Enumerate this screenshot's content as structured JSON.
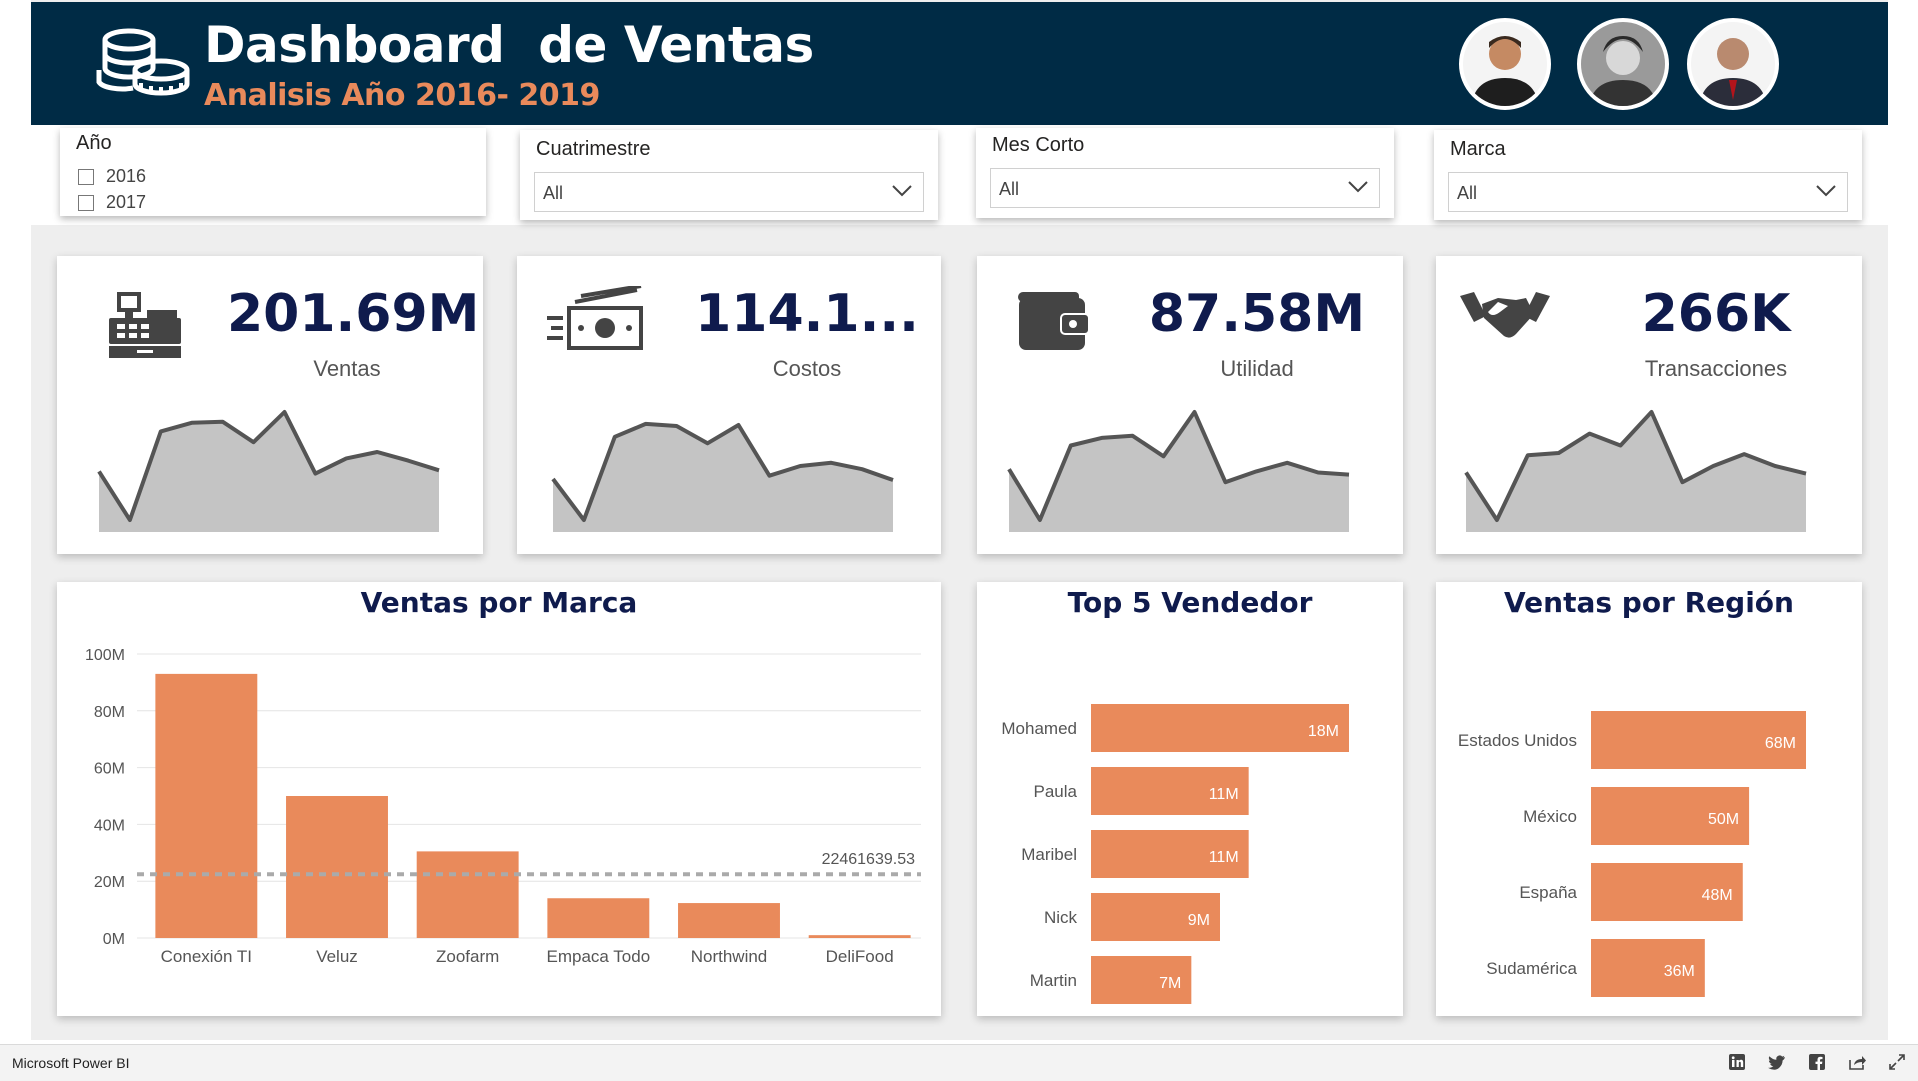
{
  "header": {
    "title": "Dashboard  de Ventas",
    "subtitle": "Analisis Año 2016- 2019",
    "logo_icon": "coins-icon",
    "avatars": [
      "avatar-1",
      "avatar-2",
      "avatar-3"
    ]
  },
  "filters": {
    "year": {
      "label": "Año",
      "options": [
        "2016",
        "2017"
      ]
    },
    "cuatrimestre": {
      "label": "Cuatrimestre",
      "value": "All"
    },
    "mes": {
      "label": "Mes Corto",
      "value": "All"
    },
    "marca": {
      "label": "Marca",
      "value": "All"
    }
  },
  "kpis": [
    {
      "value": "201.69M",
      "label": "Ventas",
      "icon": "cash-register-icon",
      "trend": [
        0.45,
        0.0,
        0.82,
        0.9,
        0.91,
        0.72,
        1.0,
        0.43,
        0.57,
        0.63,
        0.55,
        0.46
      ]
    },
    {
      "value": "114.1...",
      "label": "Costos",
      "icon": "money-bill-icon",
      "trend": [
        0.38,
        0.0,
        0.77,
        0.89,
        0.87,
        0.71,
        0.88,
        0.41,
        0.5,
        0.53,
        0.47,
        0.37
      ]
    },
    {
      "value": "87.58M",
      "label": "Utilidad",
      "icon": "wallet-icon",
      "trend": [
        0.47,
        0.0,
        0.69,
        0.76,
        0.78,
        0.59,
        1.0,
        0.35,
        0.45,
        0.53,
        0.44,
        0.42
      ]
    },
    {
      "value": "266K",
      "label": "Transacciones",
      "icon": "handshake-icon",
      "trend": [
        0.44,
        0.0,
        0.6,
        0.62,
        0.8,
        0.69,
        1.0,
        0.35,
        0.5,
        0.61,
        0.5,
        0.43
      ]
    }
  ],
  "colors": {
    "bar": "#e98a5b",
    "header": "#002b45",
    "kpi": "#0f1b4d",
    "spark_fill": "#c4c4c4",
    "spark_line": "#555555"
  },
  "charts": {
    "marca_title": "Ventas por Marca",
    "vendedor_title": "Top 5 Vendedor",
    "region_title": "Ventas por Región"
  },
  "chart_data": [
    {
      "type": "bar",
      "title": "Ventas por Marca",
      "categories": [
        "Conexión TI",
        "Veluz",
        "Zoofarm",
        "Empaca Todo",
        "Northwind",
        "DeliFood"
      ],
      "values": [
        93000000,
        50000000,
        30500000,
        14000000,
        12300000,
        1000000
      ],
      "ylim": [
        0,
        100000000
      ],
      "yticks": [
        "0M",
        "20M",
        "40M",
        "60M",
        "80M",
        "100M"
      ],
      "reference_line": {
        "value": 22461639.53,
        "label": "22461639.53"
      },
      "grid": true
    },
    {
      "type": "bar",
      "orientation": "horizontal",
      "title": "Top 5 Vendedor",
      "categories": [
        "Mohamed",
        "Paula",
        "Maribel",
        "Nick",
        "Martin"
      ],
      "values": [
        18,
        11,
        11,
        9,
        7
      ],
      "labels": [
        "18M",
        "11M",
        "11M",
        "9M",
        "7M"
      ]
    },
    {
      "type": "bar",
      "orientation": "horizontal",
      "title": "Ventas por Región",
      "categories": [
        "Estados Unidos",
        "México",
        "España",
        "Sudamérica"
      ],
      "values": [
        68,
        50,
        48,
        36
      ],
      "labels": [
        "68M",
        "50M",
        "48M",
        "36M"
      ]
    }
  ],
  "status_bar": {
    "brand": "Microsoft Power BI",
    "icons": [
      "linkedin-icon",
      "twitter-icon",
      "facebook-icon",
      "share-icon",
      "fullscreen-icon"
    ]
  }
}
